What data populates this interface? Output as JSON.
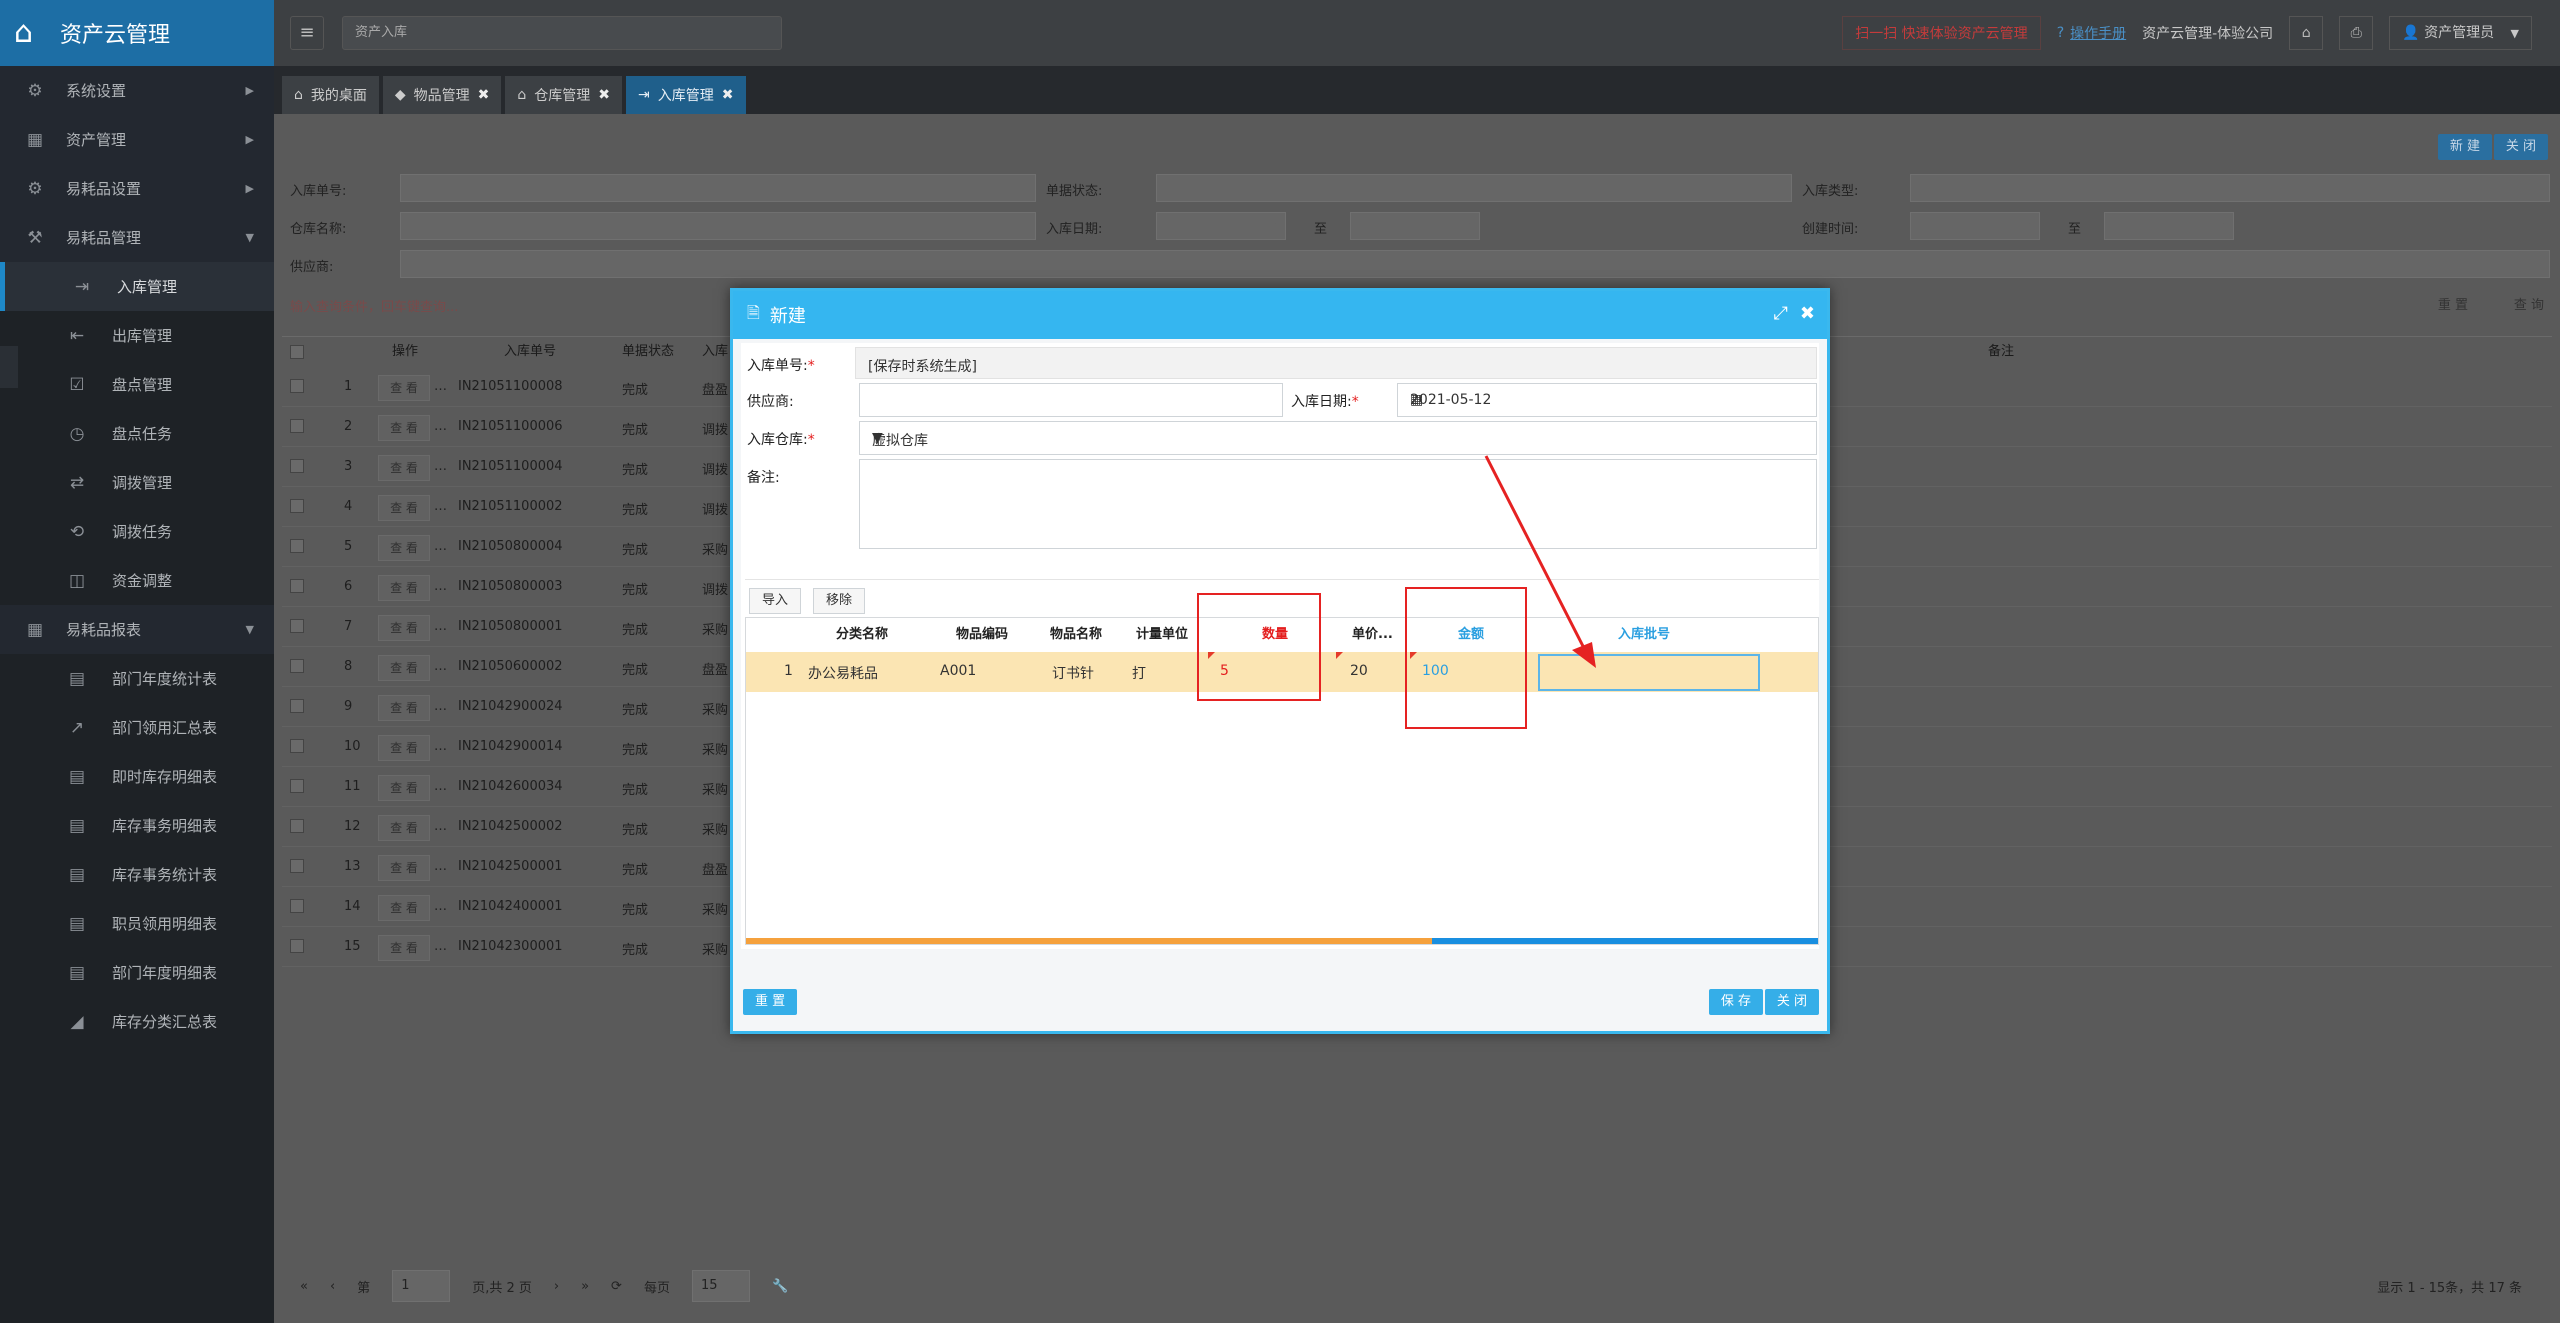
{
  "app": {
    "title": "资产云管理"
  },
  "sidebar": {
    "items": [
      {
        "label": "系统设置",
        "icon": "gears-icon",
        "type": "group"
      },
      {
        "label": "资产管理",
        "icon": "grid-icon",
        "type": "group"
      },
      {
        "label": "易耗品设置",
        "icon": "gear-icon",
        "type": "group"
      },
      {
        "label": "易耗品管理",
        "icon": "tools-icon",
        "type": "group-open"
      },
      {
        "label": "入库管理",
        "icon": "sign-in-icon",
        "type": "active"
      },
      {
        "label": "出库管理",
        "icon": "sign-out-icon",
        "type": "sub"
      },
      {
        "label": "盘点管理",
        "icon": "check-square-icon",
        "type": "sub"
      },
      {
        "label": "盘点任务",
        "icon": "clock-icon",
        "type": "sub"
      },
      {
        "label": "调拨管理",
        "icon": "shuffle-icon",
        "type": "sub"
      },
      {
        "label": "调拨任务",
        "icon": "retweet-icon",
        "type": "sub"
      },
      {
        "label": "资金调整",
        "icon": "money-icon",
        "type": "sub"
      },
      {
        "label": "易耗品报表",
        "icon": "table-icon",
        "type": "group-open"
      },
      {
        "label": "部门年度统计表",
        "icon": "sheet-icon",
        "type": "sub"
      },
      {
        "label": "部门领用汇总表",
        "icon": "line-chart-icon",
        "type": "sub"
      },
      {
        "label": "即时库存明细表",
        "icon": "sheet-icon",
        "type": "sub"
      },
      {
        "label": "库存事务明细表",
        "icon": "sheet-icon",
        "type": "sub"
      },
      {
        "label": "库存事务统计表",
        "icon": "sheet-icon",
        "type": "sub"
      },
      {
        "label": "职员领用明细表",
        "icon": "sheet-icon",
        "type": "sub"
      },
      {
        "label": "部门年度明细表",
        "icon": "sheet-icon",
        "type": "sub"
      },
      {
        "label": "库存分类汇总表",
        "icon": "area-chart-icon",
        "type": "sub"
      }
    ]
  },
  "topbar": {
    "search_value": "资产入库",
    "promo": "扫一扫 快速体验资产云管理",
    "help": "操作手册",
    "company": "资产云管理-体验公司",
    "user": "资产管理员"
  },
  "tabs": [
    {
      "label": "我的桌面",
      "icon": "home-icon",
      "closable": false,
      "active": false
    },
    {
      "label": "物品管理",
      "icon": "cube-icon",
      "closable": true,
      "active": false
    },
    {
      "label": "仓库管理",
      "icon": "bank-icon",
      "closable": true,
      "active": false
    },
    {
      "label": "入库管理",
      "icon": "sign-in-icon",
      "closable": true,
      "active": true
    }
  ],
  "page": {
    "buttons": {
      "new": "新 建",
      "close": "关 闭"
    },
    "filters": {
      "receipt_no": "入库单号:",
      "status": "单据状态:",
      "type": "入库类型:",
      "warehouse": "仓库名称:",
      "date": "入库日期:",
      "created": "创建时间:",
      "supplier": "供应商:",
      "range_sep": "至"
    },
    "hint": "输入查询条件，回车键查询...",
    "reset": "重 置",
    "query": "查 询",
    "grid": {
      "headers": {
        "op": "操作",
        "no": "入库单号",
        "status": "单据状态",
        "type": "入库",
        "remark": "备注"
      },
      "view": "查 看",
      "rows": [
        {
          "n": "1",
          "no": "IN21051100008",
          "status": "完成",
          "type": "盘盈"
        },
        {
          "n": "2",
          "no": "IN21051100006",
          "status": "完成",
          "type": "调拨"
        },
        {
          "n": "3",
          "no": "IN21051100004",
          "status": "完成",
          "type": "调拨"
        },
        {
          "n": "4",
          "no": "IN21051100002",
          "status": "完成",
          "type": "调拨"
        },
        {
          "n": "5",
          "no": "IN21050800004",
          "status": "完成",
          "type": "采购"
        },
        {
          "n": "6",
          "no": "IN21050800003",
          "status": "完成",
          "type": "调拨"
        },
        {
          "n": "7",
          "no": "IN21050800001",
          "status": "完成",
          "type": "采购"
        },
        {
          "n": "8",
          "no": "IN21050600002",
          "status": "完成",
          "type": "盘盈"
        },
        {
          "n": "9",
          "no": "IN21042900024",
          "status": "完成",
          "type": "采购"
        },
        {
          "n": "10",
          "no": "IN21042900014",
          "status": "完成",
          "type": "采购"
        },
        {
          "n": "11",
          "no": "IN21042600034",
          "status": "完成",
          "type": "采购"
        },
        {
          "n": "12",
          "no": "IN21042500002",
          "status": "完成",
          "type": "采购"
        },
        {
          "n": "13",
          "no": "IN21042500001",
          "status": "完成",
          "type": "盘盈"
        },
        {
          "n": "14",
          "no": "IN21042400001",
          "status": "完成",
          "type": "采购"
        },
        {
          "n": "15",
          "no": "IN21042300001",
          "status": "完成",
          "type": "采购"
        }
      ]
    },
    "pager": {
      "prefix": "第",
      "page": "1",
      "suffix": "页,共 2 页",
      "per_page_label": "每页",
      "per_page": "15",
      "summary": "显示 1 - 15条，共 17 条"
    }
  },
  "modal": {
    "title": "新建",
    "fields": {
      "receipt_no_label": "入库单号:",
      "receipt_no_value": "[保存时系统生成]",
      "supplier_label": "供应商:",
      "date_label": "入库日期:",
      "date_value": "2021-05-12",
      "warehouse_label": "入库仓库:",
      "warehouse_value": "虚拟仓库",
      "remark_label": "备注:"
    },
    "required_mark": "*",
    "sub_toolbar": {
      "import": "导入",
      "remove": "移除"
    },
    "detail": {
      "headers": {
        "category": "分类名称",
        "code": "物品编码",
        "name": "物品名称",
        "unit": "计量单位",
        "qty": "数量",
        "price": "单价...",
        "amount": "金额",
        "batch": "入库批号"
      },
      "row": {
        "n": "1",
        "category": "办公易耗品",
        "code": "A001",
        "name": "订书针",
        "unit": "打",
        "qty": "5",
        "price": "20",
        "amount": "100"
      }
    },
    "footer": {
      "reset": "重 置",
      "save": "保 存",
      "close": "关 闭"
    }
  },
  "colors": {
    "accent": "#35b6f0",
    "required": "#e41e1e",
    "highlight_box": "#e52222",
    "row_selected": "#fbe5b3"
  }
}
